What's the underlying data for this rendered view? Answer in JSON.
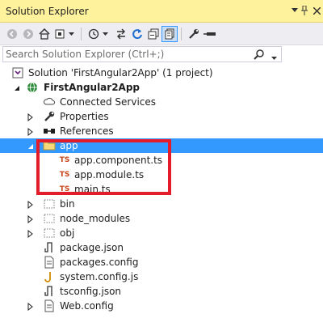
{
  "title": "Solution Explorer",
  "search": {
    "placeholder": "Search Solution Explorer (Ctrl+;)"
  },
  "toolbar": {
    "icons": [
      "back-icon",
      "forward-icon",
      "home-icon",
      "dropdown-icon",
      "history-icon",
      "dropdown-icon",
      "sync-icon",
      "refresh-icon",
      "collapse-all-icon",
      "show-all-files-icon",
      "properties-icon",
      "preview-icon"
    ]
  },
  "tree": [
    {
      "label": "Solution 'FirstAngular2App' (1 project)",
      "icon": "solution-icon",
      "expand": "none",
      "level": 0
    },
    {
      "label": "FirstAngular2App",
      "icon": "web-project-icon",
      "expand": "expanded",
      "level": 1,
      "bold": true
    },
    {
      "label": "Connected Services",
      "icon": "cloud-icon",
      "expand": "none",
      "level": 2
    },
    {
      "label": "Properties",
      "icon": "wrench-icon",
      "expand": "collapsed",
      "level": 2
    },
    {
      "label": "References",
      "icon": "references-icon",
      "expand": "collapsed",
      "level": 2
    },
    {
      "label": "app",
      "icon": "folder-icon",
      "expand": "expanded",
      "level": 2,
      "selected": true
    },
    {
      "label": "app.component.ts",
      "icon": "typescript-icon",
      "expand": "none",
      "level": 3
    },
    {
      "label": "app.module.ts",
      "icon": "typescript-icon",
      "expand": "none",
      "level": 3
    },
    {
      "label": "main.ts",
      "icon": "typescript-icon",
      "expand": "none",
      "level": 3
    },
    {
      "label": "bin",
      "icon": "folder-dotted-icon",
      "expand": "collapsed",
      "level": 2
    },
    {
      "label": "node_modules",
      "icon": "folder-dotted-icon",
      "expand": "collapsed",
      "level": 2
    },
    {
      "label": "obj",
      "icon": "folder-dotted-icon",
      "expand": "collapsed",
      "level": 2
    },
    {
      "label": "package.json",
      "icon": "json-file-icon",
      "expand": "none",
      "level": 2
    },
    {
      "label": "packages.config",
      "icon": "config-file-icon",
      "expand": "none",
      "level": 2
    },
    {
      "label": "system.config.js",
      "icon": "js-file-icon",
      "expand": "none",
      "level": 2
    },
    {
      "label": "tsconfig.json",
      "icon": "json-file-icon",
      "expand": "none",
      "level": 2
    },
    {
      "label": "Web.config",
      "icon": "config-file-icon",
      "expand": "collapsed",
      "level": 2
    }
  ],
  "ts_badge": "TS",
  "colors": {
    "selection": "#3399ff",
    "highlight_box": "#e31b2b",
    "titlebar": "#fff29d"
  }
}
